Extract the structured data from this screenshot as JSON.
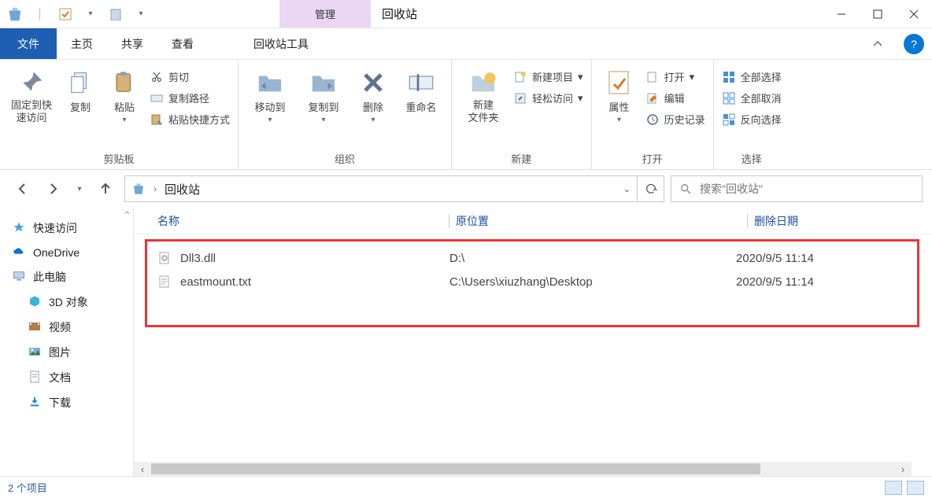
{
  "titlebar": {
    "manage_label": "管理",
    "title": "回收站"
  },
  "tabs": {
    "file": "文件",
    "home": "主页",
    "share": "共享",
    "view": "查看",
    "tool": "回收站工具"
  },
  "ribbon": {
    "clipboard": {
      "pin": "固定到快\n速访问",
      "copy": "复制",
      "paste": "粘贴",
      "cut": "剪切",
      "copy_path": "复制路径",
      "paste_shortcut": "粘贴快捷方式",
      "group": "剪贴板"
    },
    "organize": {
      "move": "移动到",
      "copy_to": "复制到",
      "delete": "删除",
      "rename": "重命名",
      "group": "组织"
    },
    "new": {
      "new_folder": "新建\n文件夹",
      "new_item": "新建项目",
      "easy_access": "轻松访问",
      "group": "新建"
    },
    "open": {
      "properties": "属性",
      "open": "打开",
      "edit": "编辑",
      "history": "历史记录",
      "group": "打开"
    },
    "select": {
      "select_all": "全部选择",
      "select_none": "全部取消",
      "invert": "反向选择",
      "group": "选择"
    }
  },
  "address": {
    "crumb": "回收站"
  },
  "search": {
    "placeholder": "搜索\"回收站\""
  },
  "columns": {
    "name": "名称",
    "original_location": "原位置",
    "deleted_date": "删除日期"
  },
  "sidebar": {
    "quick_access": "快速访问",
    "onedrive": "OneDrive",
    "this_pc": "此电脑",
    "objects_3d": "3D 对象",
    "videos": "视频",
    "pictures": "图片",
    "documents": "文档",
    "downloads": "下载"
  },
  "files": [
    {
      "name": "Dll3.dll",
      "location": "D:\\",
      "date": "2020/9/5 11:14"
    },
    {
      "name": "eastmount.txt",
      "location": "C:\\Users\\xiuzhang\\Desktop",
      "date": "2020/9/5 11:14"
    }
  ],
  "status": {
    "item_count": "2 个项目"
  }
}
